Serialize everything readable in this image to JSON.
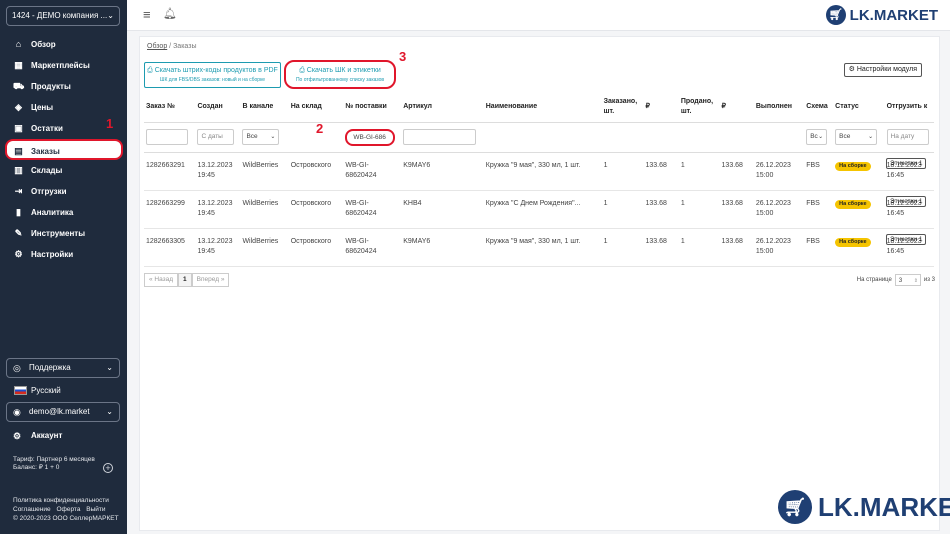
{
  "sidebar": {
    "company": "1424 - ДЕМО компания ...",
    "items": [
      {
        "label": "Обзор",
        "icon": "home-icon"
      },
      {
        "label": "Маркетплейсы",
        "icon": "store-icon"
      },
      {
        "label": "Продукты",
        "icon": "truck-icon"
      },
      {
        "label": "Цены",
        "icon": "tag-icon"
      },
      {
        "label": "Остатки",
        "icon": "box-icon"
      },
      {
        "label": "Заказы",
        "icon": "orders-icon"
      },
      {
        "label": "Склады",
        "icon": "warehouse-icon"
      },
      {
        "label": "Отгрузки",
        "icon": "shipment-icon"
      },
      {
        "label": "Аналитика",
        "icon": "chart-icon"
      },
      {
        "label": "Инструменты",
        "icon": "tools-icon"
      },
      {
        "label": "Настройки",
        "icon": "gear-icon"
      }
    ],
    "support": "Поддержка",
    "language": "Русский",
    "user": "demo@lk.market",
    "account": "Аккаунт",
    "tariff": "Тариф: Партнер 6 месяцев",
    "balance": "Баланс: ₽ 1 + 0",
    "privacy": "Политика конфиденциальности",
    "agreement": "Соглашение",
    "offer": "Оферта",
    "logout": "Выйти",
    "copyright": "© 2020-2023 ООО СеллерМАРКЕТ"
  },
  "header": {
    "logo": "LK.MARKET"
  },
  "breadcrumb": {
    "home": "Обзор",
    "separator": "/",
    "current": "Заказы"
  },
  "actions": {
    "pdf_label": "Скачать штрих-коды продуктов в PDF",
    "pdf_sub": "ШК для FBS/DBS заказов: новый и на сборке",
    "labels_label": "Скачать ШК и этикетки",
    "labels_sub": "По отфильтрованному списку заказов",
    "settings_label": "Настройки модуля"
  },
  "annotations": {
    "n1": "1",
    "n2": "2",
    "n3": "3"
  },
  "table": {
    "headers": {
      "order": "Заказ №",
      "created": "Создан",
      "channel": "В канале",
      "warehouse": "На склад",
      "shipment": "№ поставки",
      "sku": "Артикул",
      "name": "Наименование",
      "ordered": "Заказано, шт.",
      "price1": "₽",
      "sold": "Продано, шт.",
      "price2": "₽",
      "done": "Выполнен",
      "scheme": "Схема",
      "status": "Статус",
      "ship": "Отгрузить к"
    },
    "filters": {
      "created_placeholder": "С даты",
      "channel": "Все",
      "shipment_value": "WB-GI-686",
      "scheme": "Вс",
      "status": "Все",
      "ship_placeholder": "На дату"
    },
    "rows": [
      {
        "order": "1282663291",
        "created": "13.12.2023 19:45",
        "channel": "WildBerries",
        "warehouse": "Островского",
        "shipment": "WB-GI-68620424",
        "sku": "K9MAY6",
        "name": "Кружка \"9 мая\", 330 мл, 1 шт.",
        "ordered": "1",
        "price1": "133.68",
        "sold": "1",
        "price2": "133.68",
        "done": "26.12.2023 15:00",
        "scheme": "FBS",
        "status": "На сборке",
        "ship": "18.12.2023 16:45",
        "action": "Этикетки 1"
      },
      {
        "order": "1282663299",
        "created": "13.12.2023 19:45",
        "channel": "WildBerries",
        "warehouse": "Островского",
        "shipment": "WB-GI-68620424",
        "sku": "KHB4",
        "name": "Кружка \"С Днем Рождения\"...",
        "ordered": "1",
        "price1": "133.68",
        "sold": "1",
        "price2": "133.68",
        "done": "26.12.2023 15:00",
        "scheme": "FBS",
        "status": "На сборке",
        "ship": "18.12.2023 16:45",
        "action": "Этикетки 1"
      },
      {
        "order": "1282663305",
        "created": "13.12.2023 19:45",
        "channel": "WildBerries",
        "warehouse": "Островского",
        "shipment": "WB-GI-68620424",
        "sku": "K9MAY6",
        "name": "Кружка \"9 мая\", 330 мл, 1 шт.",
        "ordered": "1",
        "price1": "133.68",
        "sold": "1",
        "price2": "133.68",
        "done": "26.12.2023 15:00",
        "scheme": "FBS",
        "status": "На сборке",
        "ship": "18.12.2023 16:45",
        "action": "Этикетки 1"
      }
    ]
  },
  "pagination": {
    "prev": "« Назад",
    "current": "1",
    "next": "Вперед »",
    "per_page_label": "На странице",
    "per_page_value": "3",
    "of_label": "из 3"
  },
  "watermark": {
    "logo": "LK.MARKET"
  }
}
